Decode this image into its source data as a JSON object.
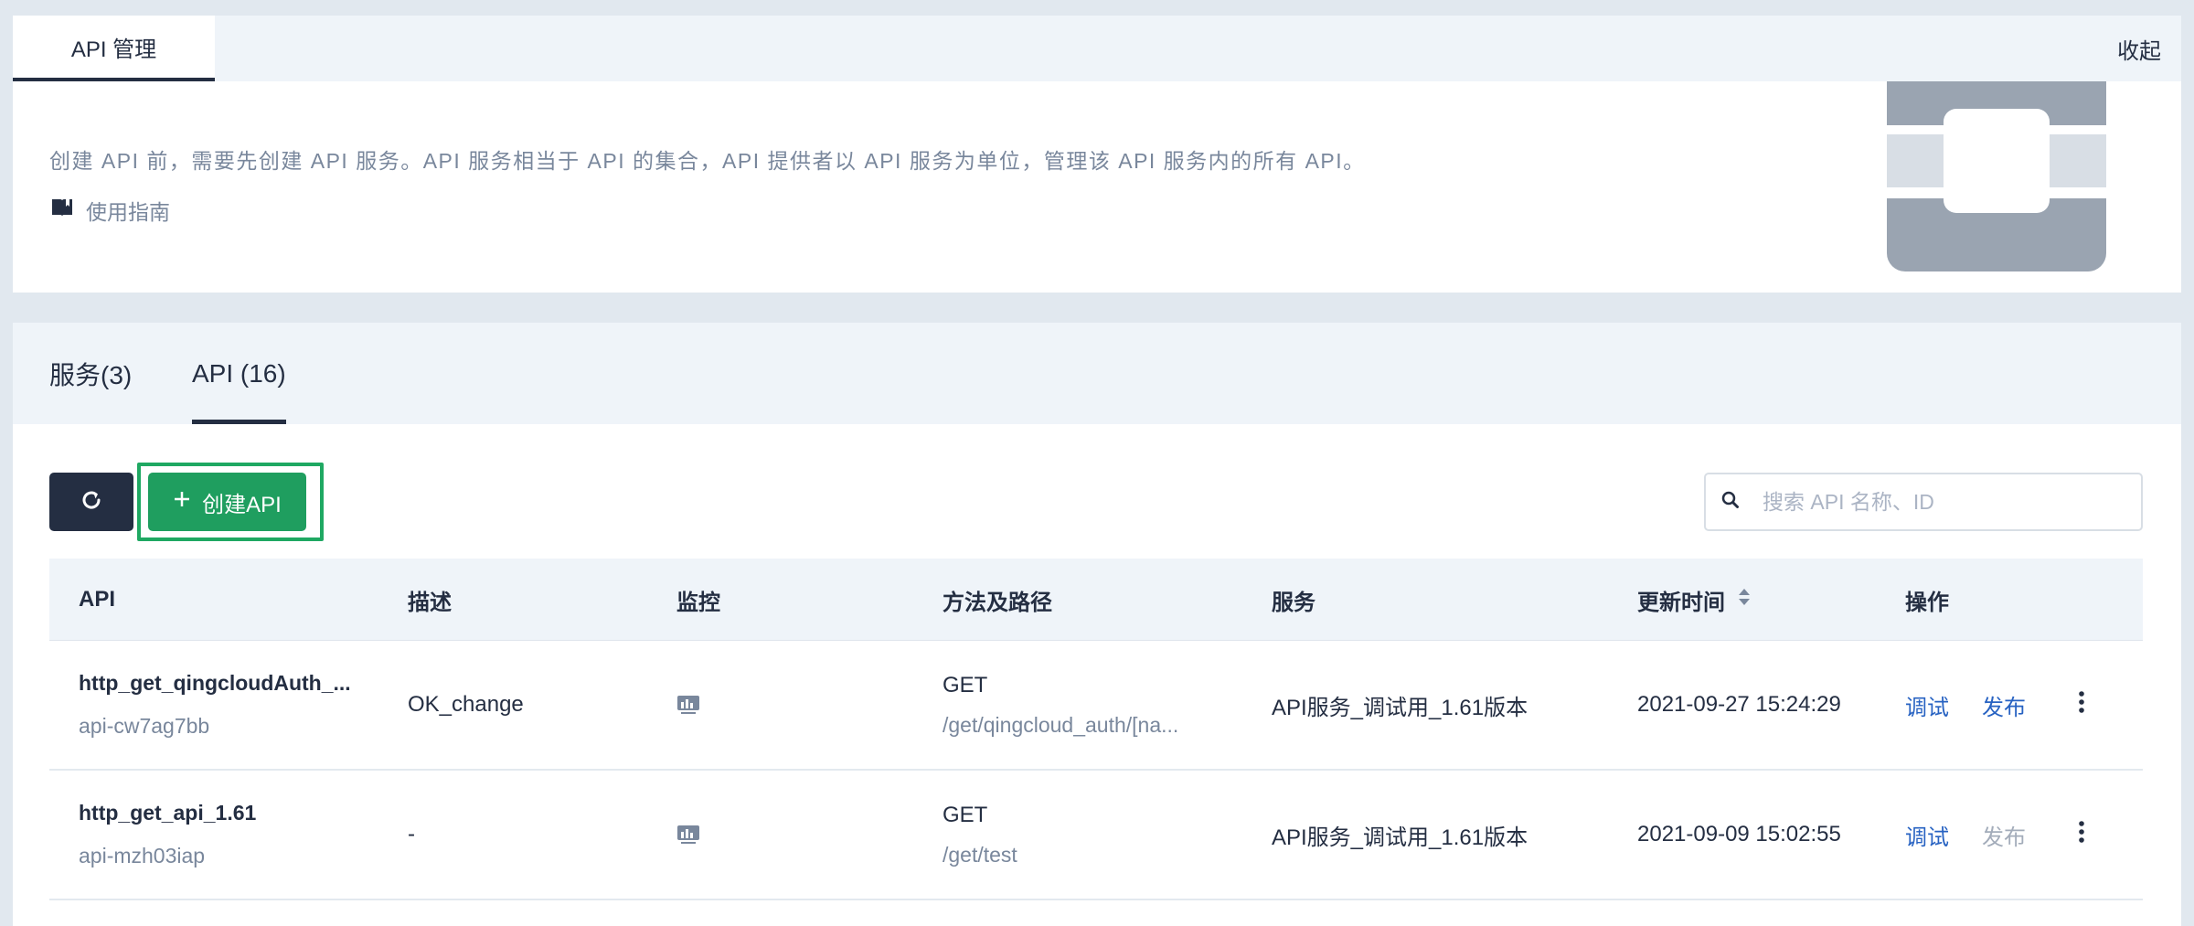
{
  "top": {
    "tab_label": "API 管理",
    "collapse_label": "收起",
    "intro": "创建 API 前，需要先创建 API 服务。API 服务相当于 API 的集合，API 提供者以 API 服务为单位，管理该 API 服务内的所有 API。",
    "guide_label": "使用指南"
  },
  "tabs": [
    {
      "label": "服务(3)",
      "active": false
    },
    {
      "label": "API (16)",
      "active": true
    }
  ],
  "toolbar": {
    "create_label": "创建API",
    "search_placeholder": "搜索 API 名称、ID"
  },
  "table": {
    "columns": [
      "API",
      "描述",
      "监控",
      "方法及路径",
      "服务",
      "更新时间",
      "操作"
    ],
    "rows": [
      {
        "name": "http_get_qingcloudAuth_...",
        "id": "api-cw7ag7bb",
        "description": "OK_change",
        "method": "GET",
        "path": "/get/qingcloud_auth/[na...",
        "service": "API服务_调试用_1.61版本",
        "updated": "2021-09-27 15:24:29",
        "debug": "调试",
        "publish": "发布",
        "publish_enabled": true
      },
      {
        "name": "http_get_api_1.61",
        "id": "api-mzh03iap",
        "description": "-",
        "method": "GET",
        "path": "/get/test",
        "service": "API服务_调试用_1.61版本",
        "updated": "2021-09-09 15:02:55",
        "debug": "调试",
        "publish": "发布",
        "publish_enabled": false
      }
    ]
  },
  "icons": {
    "guide": "book-icon",
    "refresh": "refresh-icon",
    "create": "plus-icon",
    "search": "search-icon",
    "monitor": "monitor-chart-icon",
    "sort": "sort-icon",
    "more": "more-vertical-icon"
  },
  "colors": {
    "primary_dark": "#242e42",
    "create_green": "#1f9e5f",
    "highlight_outline": "#1fa862",
    "link_blue": "#2762c2",
    "muted_text": "#79879c"
  }
}
